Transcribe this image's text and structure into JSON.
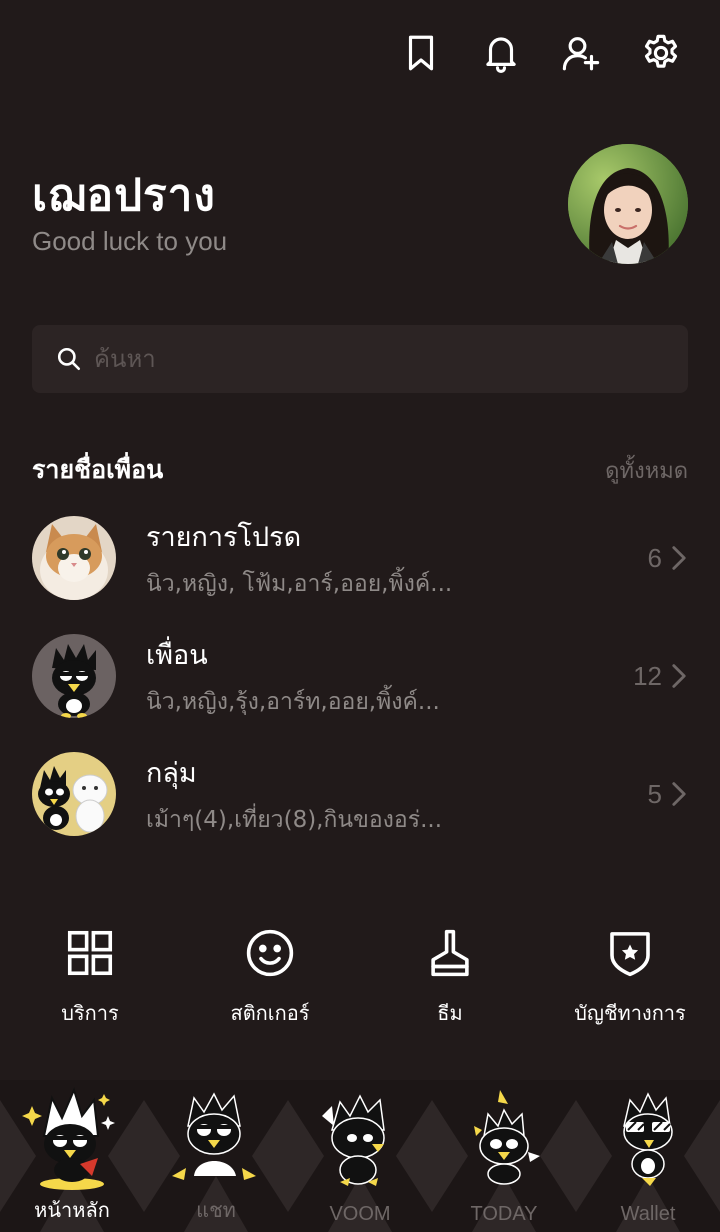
{
  "topbar": {
    "icons": [
      "bookmark-icon",
      "bell-icon",
      "add-friend-icon",
      "gear-icon"
    ]
  },
  "profile": {
    "name": "เฌอปราง",
    "status": "Good luck to you"
  },
  "search": {
    "placeholder": "ค้นหา"
  },
  "friends_section": {
    "title": "รายชื่อเพื่อน",
    "view_all": "ดูทั้งหมด",
    "rows": [
      {
        "title": "รายการโปรด",
        "subtitle": "นิว,หญิง, โฟ้ม,อาร์,ออย,พิ้งค์...",
        "count": "6"
      },
      {
        "title": "เพื่อน",
        "subtitle": "นิว,หญิง,รุ้ง,อาร์ท,ออย,พิ้งค์...",
        "count": "12"
      },
      {
        "title": "กลุ่ม",
        "subtitle": "เม้าๆ(4),เที่ยว(8),กินของอร่...",
        "count": "5"
      }
    ]
  },
  "services": [
    {
      "label": "บริการ",
      "icon": "grid-icon"
    },
    {
      "label": "สติกเกอร์",
      "icon": "smiley-icon"
    },
    {
      "label": "ธีม",
      "icon": "brush-icon"
    },
    {
      "label": "บัญชีทางการ",
      "icon": "shield-star-icon"
    }
  ],
  "tabs": [
    {
      "label": "หน้าหลัก",
      "active": true
    },
    {
      "label": "แชท",
      "active": false
    },
    {
      "label": "VOOM",
      "active": false
    },
    {
      "label": "TODAY",
      "active": false
    },
    {
      "label": "Wallet",
      "active": false
    }
  ],
  "colors": {
    "background": "#211a1a",
    "search_bg": "#2c2424",
    "muted_text": "#8f8a88",
    "dim_text": "#6e6766",
    "mascot_yellow": "#f5d84a"
  }
}
